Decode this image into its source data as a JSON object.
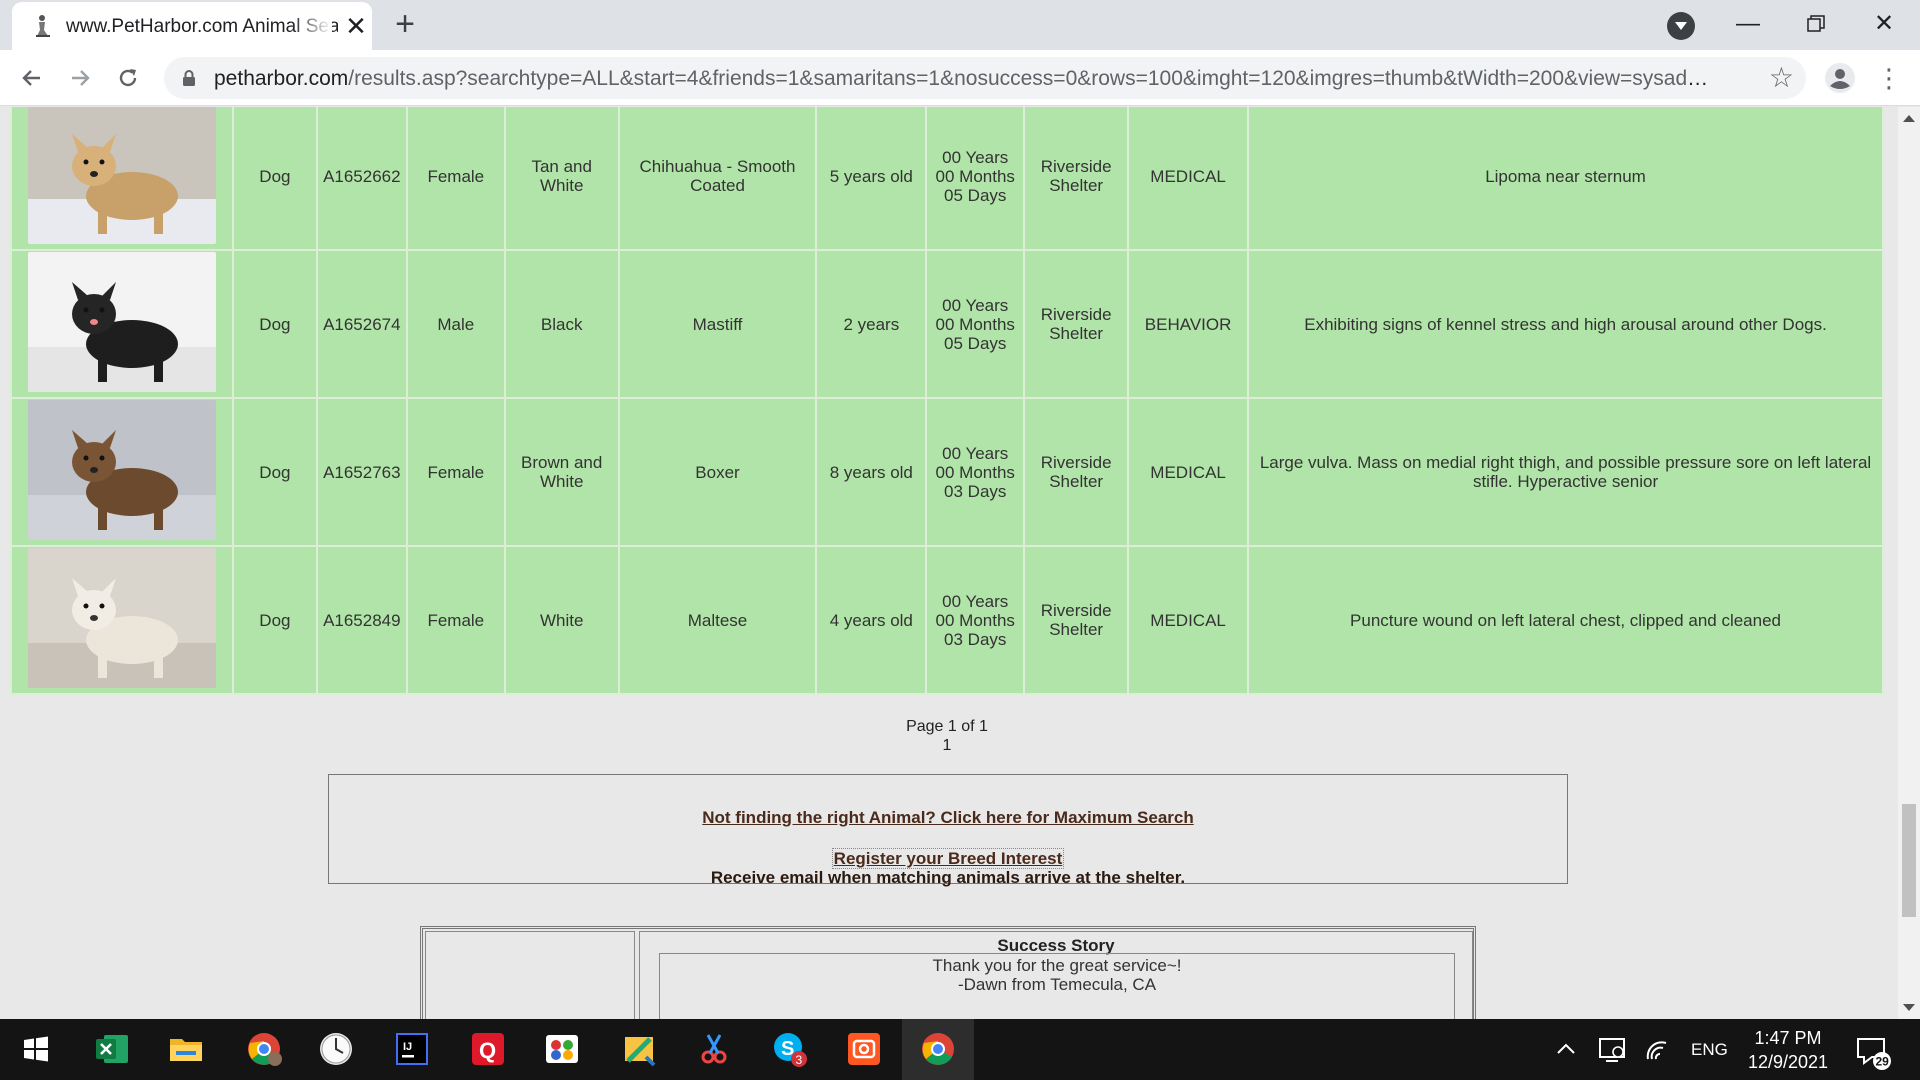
{
  "browser": {
    "tab_title": "www.PetHarbor.com Animal Search",
    "url_host": "petharbor.com",
    "url_path": "/results.asp?searchtype=ALL&start=4&friends=1&samaritans=1&nosuccess=0&rows=100&imght=120&imgres=thumb&tWidth=200&view=sysadm..."
  },
  "results": [
    {
      "type": "Dog",
      "id": "A1652662",
      "sex": "Female",
      "color": "Tan and White",
      "breed": "Chihuahua - Smooth Coated",
      "age": "5 years old",
      "time_line1": "00 Years",
      "time_line2": "00 Months",
      "time_line3": "05 Days",
      "location": "Riverside Shelter",
      "reason": "MEDICAL",
      "notes": "Lipoma near sternum"
    },
    {
      "type": "Dog",
      "id": "A1652674",
      "sex": "Male",
      "color": "Black",
      "breed": "Mastiff",
      "age": "2 years",
      "time_line1": "00 Years",
      "time_line2": "00 Months",
      "time_line3": "05 Days",
      "location": "Riverside Shelter",
      "reason": "BEHAVIOR",
      "notes": "Exhibiting signs of kennel stress and high arousal around other Dogs."
    },
    {
      "type": "Dog",
      "id": "A1652763",
      "sex": "Female",
      "color": "Brown and White",
      "breed": "Boxer",
      "age": "8 years old",
      "time_line1": "00 Years",
      "time_line2": "00 Months",
      "time_line3": "03 Days",
      "location": "Riverside Shelter",
      "reason": "MEDICAL",
      "notes": "Large vulva. Mass on medial right thigh, and possible pressure sore on left lateral stifle. Hyperactive senior"
    },
    {
      "type": "Dog",
      "id": "A1652849",
      "sex": "Female",
      "color": "White",
      "breed": "Maltese",
      "age": "4 years old",
      "time_line1": "00 Years",
      "time_line2": "00 Months",
      "time_line3": "03 Days",
      "location": "Riverside Shelter",
      "reason": "MEDICAL",
      "notes": "Puncture wound on left lateral chest, clipped and cleaned"
    }
  ],
  "pager": {
    "status": "Page 1 of 1",
    "current": "1"
  },
  "promo": {
    "max_search_link": "Not finding the right Animal? Click here for Maximum Search",
    "breed_interest_link": "Register your Breed Interest",
    "breed_interest_desc": "Receive email when matching animals arrive at the shelter."
  },
  "success_story": {
    "heading": "Success Story",
    "line1": "Thank you for the great service~!",
    "line2": "-Dawn from Temecula, CA"
  },
  "taskbar": {
    "language": "ENG",
    "time": "1:47 PM",
    "date": "12/9/2021",
    "notification_count": "29",
    "skype_badge": "3"
  }
}
